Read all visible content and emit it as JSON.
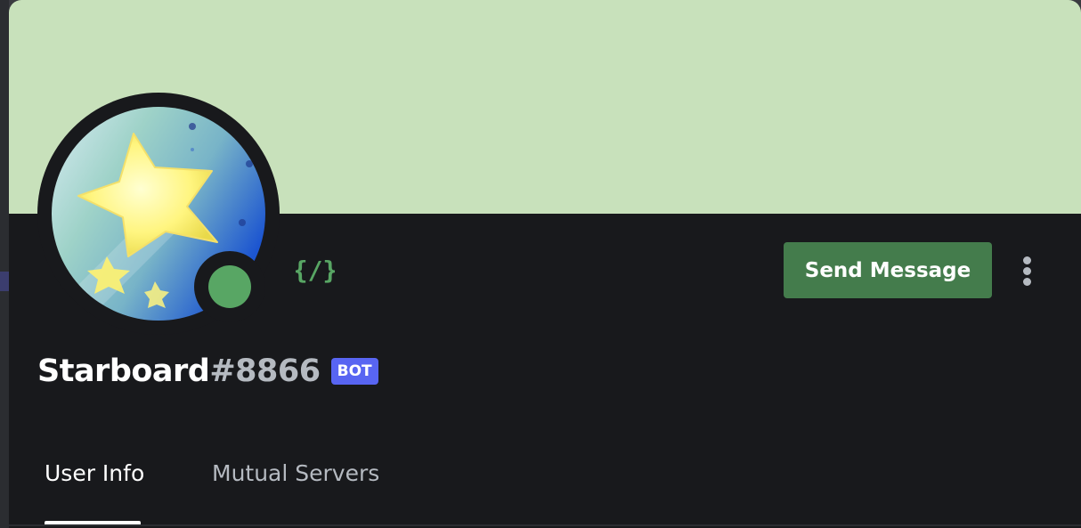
{
  "colors": {
    "banner": "#c8e1bb",
    "card_background": "#18191c",
    "status_online": "#58a664",
    "slash_badge": "#58a664",
    "send_button": "#447c4c",
    "bot_tag": "#5865f2"
  },
  "profile": {
    "username": "Starboard",
    "discriminator": "#8866",
    "bot_tag": "BOT",
    "status": "online",
    "badge_icon": "slash-commands-icon",
    "avatar_icon": "star-icon"
  },
  "actions": {
    "send_message_label": "Send Message",
    "more_icon": "more-vertical-icon"
  },
  "tabs": [
    {
      "label": "User Info",
      "active": true
    },
    {
      "label": "Mutual Servers",
      "active": false
    }
  ]
}
